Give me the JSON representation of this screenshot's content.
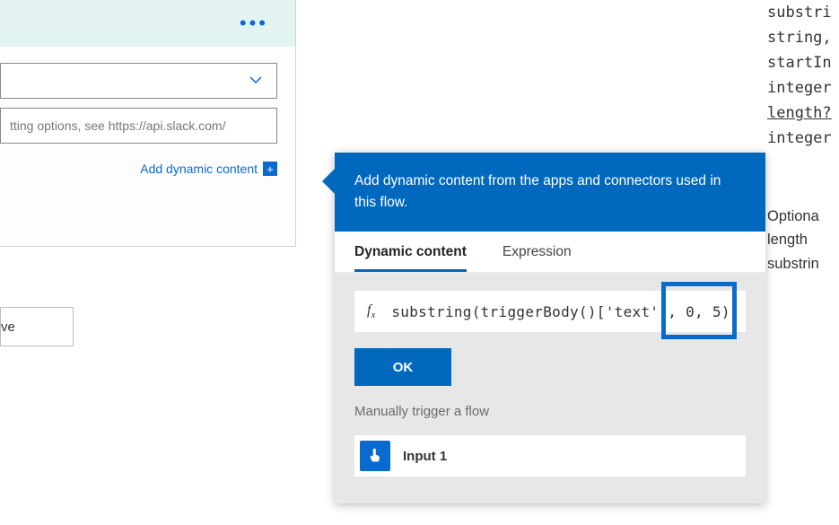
{
  "action_card": {
    "placeholder": "tting options, see https://api.slack.com/",
    "add_dynamic_label": "Add dynamic content"
  },
  "save_button": {
    "label": "ve"
  },
  "flyout": {
    "header": "Add dynamic content from the apps and connectors used in this flow.",
    "tabs": {
      "dynamic": "Dynamic content",
      "expression": "Expression"
    },
    "expression_value": "substring(triggerBody()['text'], 0, 5)",
    "ok_label": "OK",
    "trigger_section": "Manually trigger a flow",
    "items": [
      {
        "label": "Input 1",
        "icon": "touch-icon"
      }
    ]
  },
  "docs": {
    "lines": [
      "substri",
      "string,",
      "startIn",
      "integer",
      "length?",
      "integer"
    ],
    "desc": [
      "Optiona",
      "length",
      "substrin"
    ]
  }
}
